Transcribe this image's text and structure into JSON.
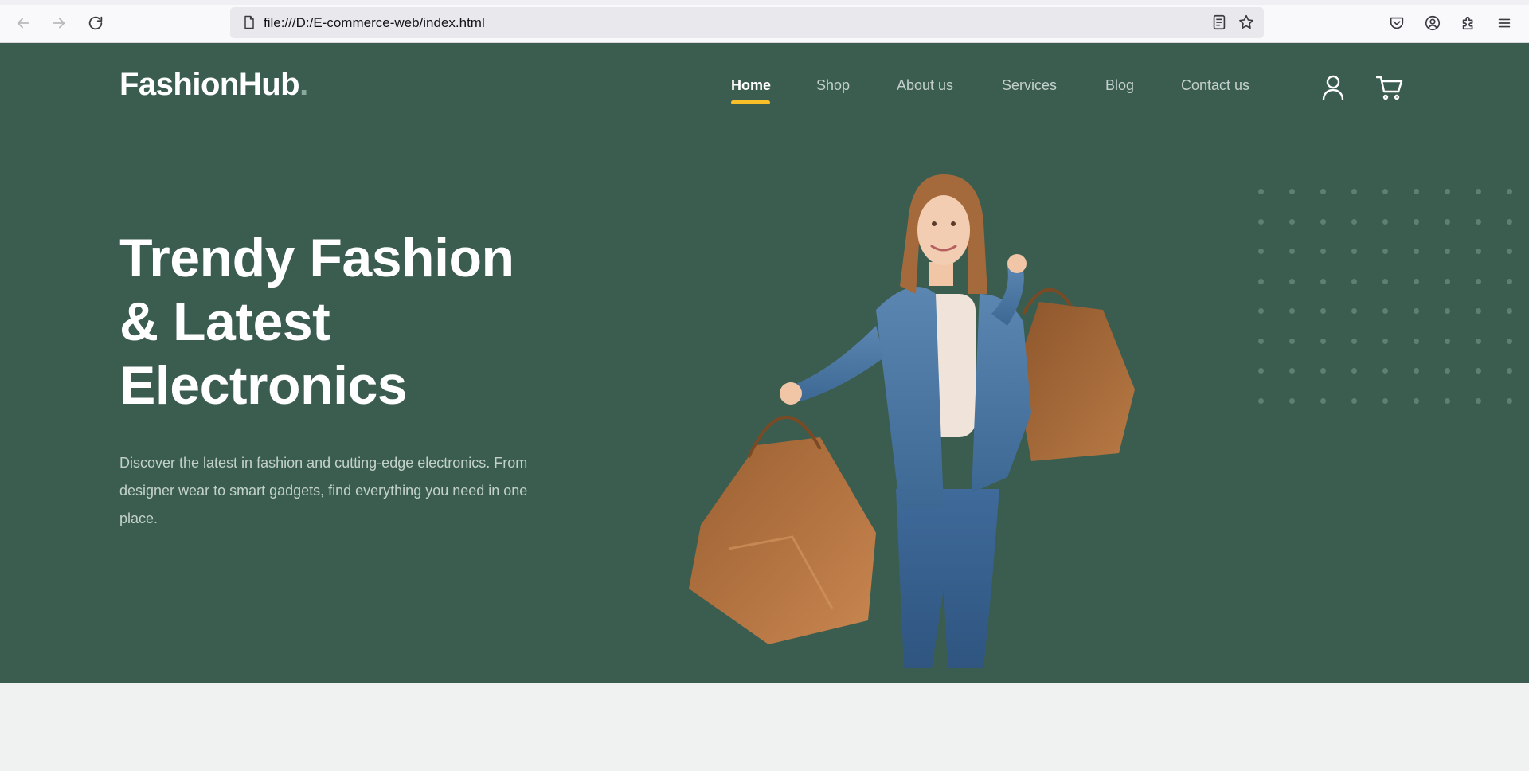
{
  "browser": {
    "url": "file:///D:/E-commerce-web/index.html",
    "icons": [
      "back-arrow-icon",
      "forward-arrow-icon",
      "reload-icon",
      "page-icon",
      "reader-view-icon",
      "bookmark-star-icon",
      "pocket-icon",
      "account-icon",
      "extensions-icon",
      "menu-icon"
    ]
  },
  "header": {
    "logo_text": "FashionHub",
    "logo_dot": ".",
    "nav": [
      {
        "label": "Home"
      },
      {
        "label": "Shop"
      },
      {
        "label": "About us"
      },
      {
        "label": "Services"
      },
      {
        "label": "Blog"
      },
      {
        "label": "Contact us"
      }
    ],
    "icons": [
      "user-icon",
      "cart-icon"
    ]
  },
  "hero": {
    "title_line1": "Trendy Fashion",
    "title_line2": "& Latest",
    "title_line3": "Electronics",
    "description": "Discover the latest in fashion and cutting-edge electronics. From designer wear to smart gadgets, find everything you need in one place.",
    "image": "woman-with-shopping-bags"
  },
  "colors": {
    "hero_bg": "#3b5d50",
    "accent": "#f9bf29",
    "page_bg": "#eff2f1"
  }
}
